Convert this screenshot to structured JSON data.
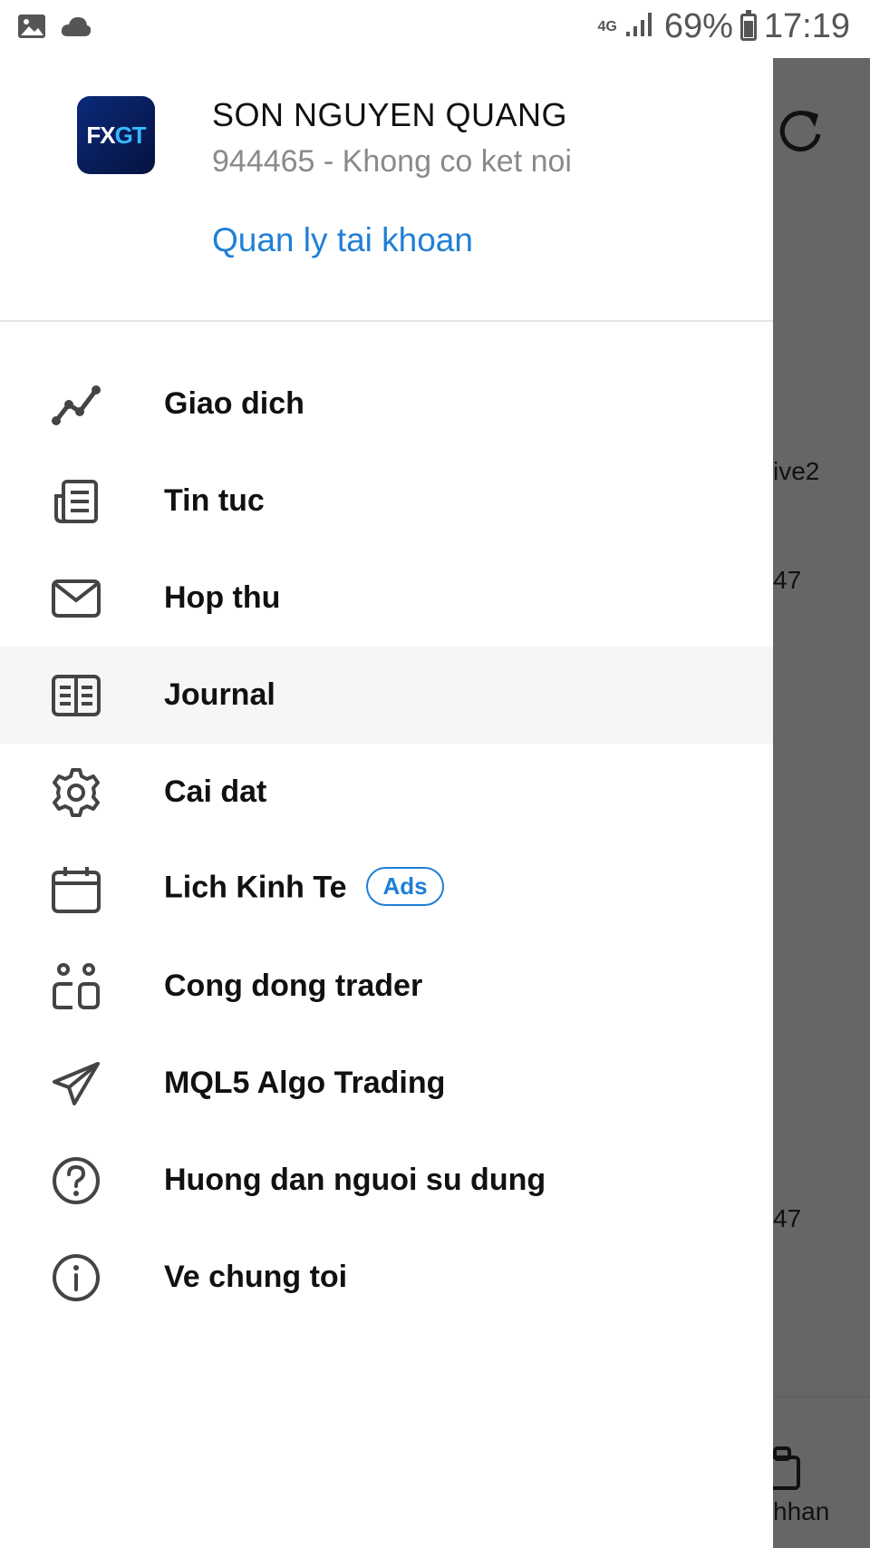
{
  "status_bar": {
    "network": "4G",
    "battery": "69%",
    "time": "17:19"
  },
  "account": {
    "logo_left": "FX",
    "logo_right": "GT",
    "name": "SON NGUYEN QUANG",
    "subtitle": "944465 - Khong co ket noi",
    "manage_link": "Quan ly tai khoan"
  },
  "menu": {
    "items": [
      {
        "label": "Giao dich",
        "icon": "chart-line-icon"
      },
      {
        "label": "Tin tuc",
        "icon": "news-icon"
      },
      {
        "label": "Hop thu",
        "icon": "mail-icon"
      },
      {
        "label": "Journal",
        "icon": "journal-icon"
      },
      {
        "label": "Cai dat",
        "icon": "gear-icon"
      },
      {
        "label": "Lich Kinh Te",
        "icon": "calendar-icon",
        "badge": "Ads"
      },
      {
        "label": "Cong dong trader",
        "icon": "community-icon"
      },
      {
        "label": "MQL5 Algo Trading",
        "icon": "send-icon"
      },
      {
        "label": "Huong dan nguoi su dung",
        "icon": "help-icon"
      },
      {
        "label": "Ve chung toi",
        "icon": "info-icon"
      }
    ],
    "active_index": 3
  },
  "underlay": {
    "text_1": "ive2",
    "text_2": "47",
    "text_3": "47",
    "bottom_label": "hhan"
  },
  "colors": {
    "accent": "#1f7fd6",
    "overlay": "#666666",
    "active_row": "#f6f6f6"
  }
}
